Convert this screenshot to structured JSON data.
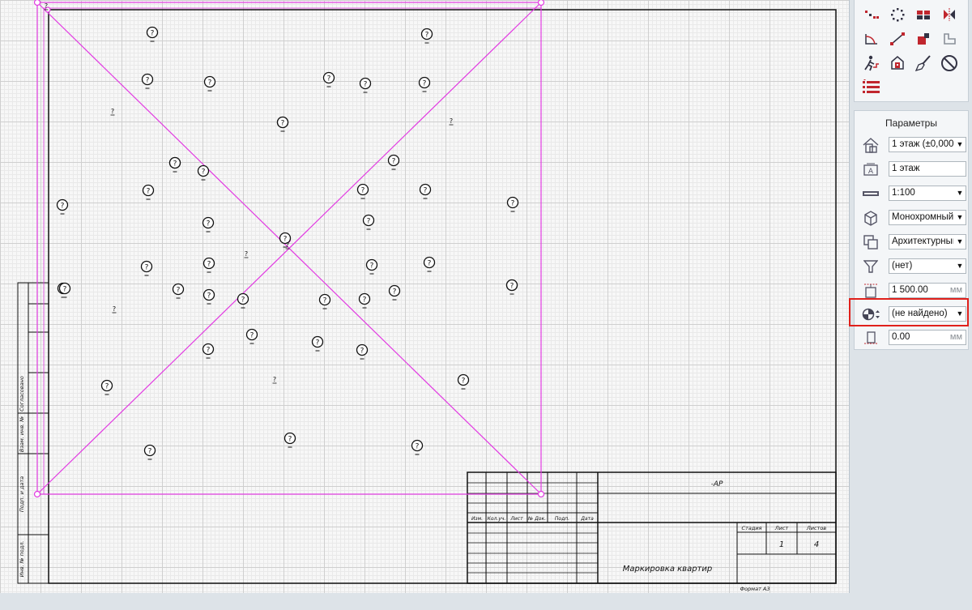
{
  "drawing": {
    "markers": {
      "symbol": "?",
      "count": 44
    },
    "free_labels": {
      "symbol": "?",
      "count": 7
    },
    "title_block": {
      "code": "-АР",
      "col_headers": [
        "Изм.",
        "Кол.уч.",
        "Лист",
        "№ Док.",
        "Подп.",
        "Дата"
      ],
      "stage_header": "Стадия",
      "sheet_header": "Лист",
      "sheets_header": "Листов",
      "sheet_value": "1",
      "sheets_value": "4",
      "sheet_title": "Маркировка квартир",
      "format": "Формат А3"
    },
    "side_stamp": [
      "Согласовано",
      "Взам. инв. №",
      "Подп. и дата",
      "Инв. № подл."
    ]
  },
  "tools": {
    "icons": [
      "select-points-icon",
      "distribute-points-icon",
      "window-layout-icon",
      "mirror-icon",
      "angle-dimension-icon",
      "diagonal-line-icon",
      "red-squares-icon",
      "corner-icon",
      "person-stairs-icon",
      "fill-bucket-icon",
      "brush-icon",
      "prohibit-icon",
      "numbered-list-icon"
    ]
  },
  "params": {
    "title": "Параметры",
    "floor": "1 этаж (±0,000)",
    "floor_name": "1 этаж",
    "scale": "1:100",
    "color_mode": "Монохромный",
    "discipline": "Архитектурный",
    "filter": "(нет)",
    "height_value": "1 500.00",
    "height_unit": "мм",
    "pattern": "(не найдено)",
    "offset_value": "0.00",
    "offset_unit": "мм"
  },
  "colors": {
    "magenta": "#e23ae2",
    "highlight": "#e0201b",
    "ink": "#111111"
  }
}
